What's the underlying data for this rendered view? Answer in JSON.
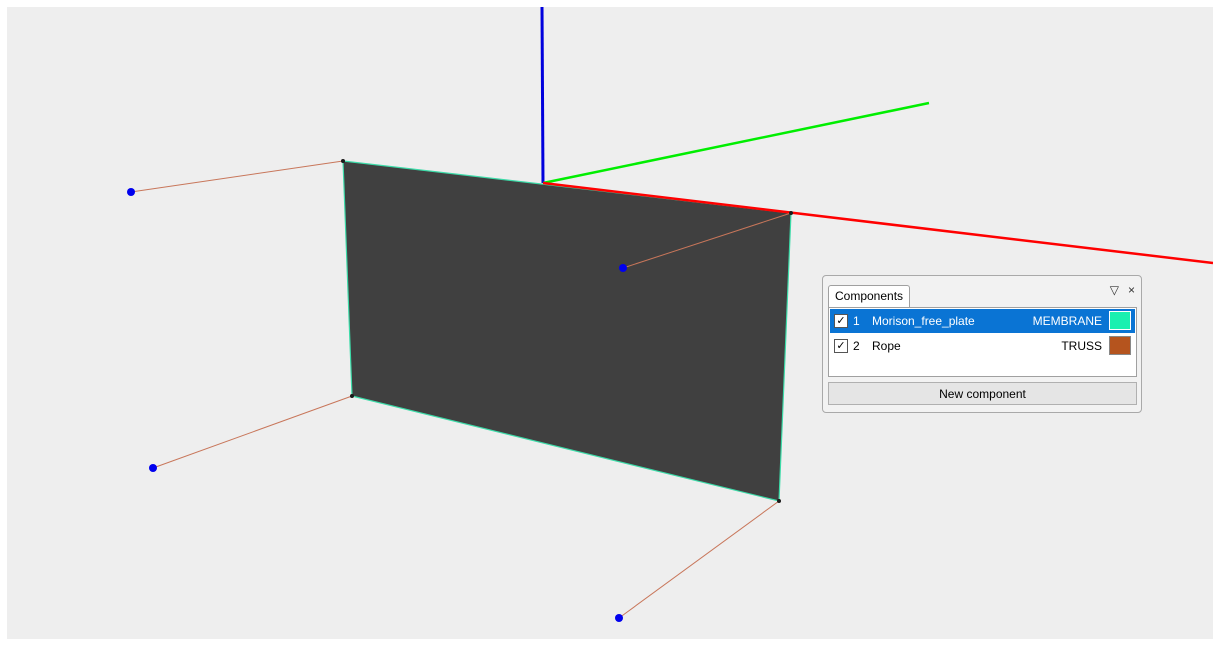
{
  "viewport": {
    "background": "#eeeeee",
    "axes": {
      "x_color": "#ff0000",
      "y_color": "#00ee00",
      "z_color": "#0000dd"
    },
    "plate_color": "#404040",
    "plate_edge_color": "#3cdba8",
    "rope_color": "#c8765a",
    "anchor_color": "#0000ee"
  },
  "components_panel": {
    "tab_label": "Components",
    "float_icon": "▽",
    "close_icon": "×",
    "items": [
      {
        "checked": "✓",
        "index": "1",
        "name": "Morison_free_plate",
        "type": "MEMBRANE",
        "color": "#19f0b0",
        "selected": true
      },
      {
        "checked": "✓",
        "index": "2",
        "name": "Rope",
        "type": "TRUSS",
        "color": "#b5541e",
        "selected": false
      }
    ],
    "new_component_label": "New component"
  }
}
